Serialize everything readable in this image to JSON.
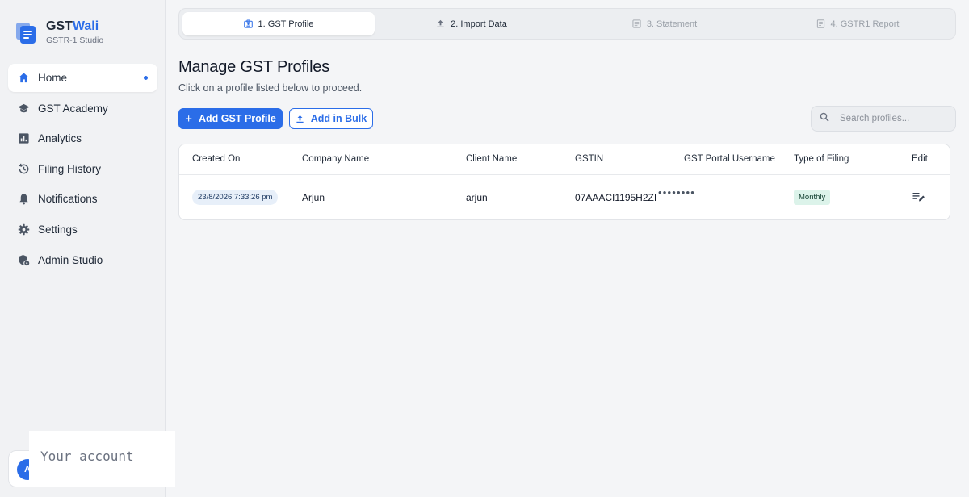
{
  "brand": {
    "name_part1": "GST",
    "name_part2": "Wali",
    "subtitle": "GSTR-1 Studio",
    "accent": "#2b6de8"
  },
  "sidebar": {
    "items": [
      {
        "label": "Home",
        "icon": "home-icon",
        "active": true
      },
      {
        "label": "GST Academy",
        "icon": "graduation-cap-icon"
      },
      {
        "label": "Analytics",
        "icon": "analytics-icon"
      },
      {
        "label": "Filing History",
        "icon": "history-icon"
      },
      {
        "label": "Notifications",
        "icon": "bell-icon"
      },
      {
        "label": "Settings",
        "icon": "gear-icon"
      },
      {
        "label": "Admin Studio",
        "icon": "admin-shield-icon"
      }
    ],
    "account": {
      "avatar_initial": "A",
      "tooltip": "Your account"
    }
  },
  "stepper": {
    "steps": [
      {
        "label": "1. GST Profile",
        "icon": "profile-card-icon",
        "state": "active"
      },
      {
        "label": "2. Import Data",
        "icon": "upload-icon",
        "state": "done"
      },
      {
        "label": "3. Statement",
        "icon": "statement-icon",
        "state": "pending"
      },
      {
        "label": "4. GSTR1 Report",
        "icon": "report-icon",
        "state": "pending"
      }
    ]
  },
  "main": {
    "title": "Manage GST Profiles",
    "subtitle": "Click on a profile listed below to proceed.",
    "add_button": "Add GST Profile",
    "bulk_button": "Add in Bulk",
    "search_placeholder": "Search profiles..."
  },
  "table": {
    "columns": [
      "Created On",
      "Company Name",
      "Client Name",
      "GSTIN",
      "GST Portal Username",
      "Type of Filing",
      "Edit"
    ],
    "rows": [
      {
        "created_on": "23/8/2026 7:33:26 pm",
        "company_name": "Arjun",
        "client_name": "arjun",
        "gstin": "07AAACI1195H2ZI",
        "portal_username": "••••••••",
        "type_of_filing": "Monthly"
      }
    ]
  }
}
